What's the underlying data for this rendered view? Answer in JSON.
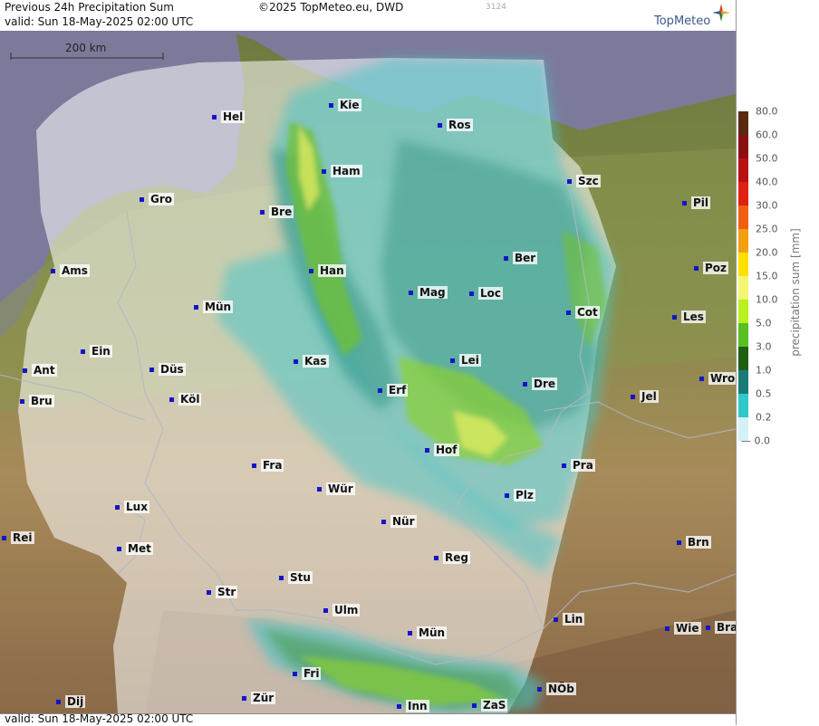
{
  "header": {
    "title": "Previous 24h Precipitation Sum",
    "valid": "valid:  Sun  18-May-2025 02:00 UTC",
    "copyright": "©2025 TopMeteo.eu, DWD",
    "code": "3124",
    "logo": "TopMeteo"
  },
  "scale_bar": {
    "label": "200 km"
  },
  "footer": {
    "valid": "valid:  Sun  18-May-2025 02:00 UTC"
  },
  "legend": {
    "title": "precipitation sum [mm]",
    "items": [
      {
        "label": "80.0",
        "color": "#5a2a10"
      },
      {
        "label": "60.0",
        "color": "#8a1010"
      },
      {
        "label": "50.0",
        "color": "#b81010"
      },
      {
        "label": "40.0",
        "color": "#e02010"
      },
      {
        "label": "30.0",
        "color": "#f06010"
      },
      {
        "label": "25.0",
        "color": "#f2a010"
      },
      {
        "label": "20.0",
        "color": "#ffe000"
      },
      {
        "label": "15.0",
        "color": "#f5f570"
      },
      {
        "label": "10.0",
        "color": "#b8f020"
      },
      {
        "label": "5.0",
        "color": "#58c020"
      },
      {
        "label": "3.0",
        "color": "#1f6010"
      },
      {
        "label": "1.0",
        "color": "#1a7a78"
      },
      {
        "label": "0.5",
        "color": "#30c8c8"
      },
      {
        "label": "0.2",
        "color": "#d4f2f4"
      },
      {
        "label": "0.0",
        "color": "#ffffff"
      }
    ]
  },
  "cities": [
    {
      "name": "Kie"
    },
    {
      "name": "Hel"
    },
    {
      "name": "Ros"
    },
    {
      "name": "Ham"
    },
    {
      "name": "Szc"
    },
    {
      "name": "Gro"
    },
    {
      "name": "Bre"
    },
    {
      "name": "Pil"
    },
    {
      "name": "Ber"
    },
    {
      "name": "Ams"
    },
    {
      "name": "Han"
    },
    {
      "name": "Poz"
    },
    {
      "name": "Mag"
    },
    {
      "name": "Loc"
    },
    {
      "name": "Mün"
    },
    {
      "name": "Cot"
    },
    {
      "name": "Les"
    },
    {
      "name": "Ein"
    },
    {
      "name": "Kas"
    },
    {
      "name": "Lei"
    },
    {
      "name": "Ant"
    },
    {
      "name": "Düs"
    },
    {
      "name": "Wro"
    },
    {
      "name": "Erf"
    },
    {
      "name": "Dre"
    },
    {
      "name": "Bru"
    },
    {
      "name": "Köl"
    },
    {
      "name": "Jel"
    },
    {
      "name": "Hof"
    },
    {
      "name": "Fra"
    },
    {
      "name": "Pra"
    },
    {
      "name": "Wür"
    },
    {
      "name": "Plz"
    },
    {
      "name": "Lux"
    },
    {
      "name": "Nür"
    },
    {
      "name": "Rei"
    },
    {
      "name": "Met"
    },
    {
      "name": "Reg"
    },
    {
      "name": "Brn"
    },
    {
      "name": "Stu"
    },
    {
      "name": "Str"
    },
    {
      "name": "Ulm"
    },
    {
      "name": "Lin"
    },
    {
      "name": "Mün"
    },
    {
      "name": "Wie"
    },
    {
      "name": "Bra"
    },
    {
      "name": "Fri"
    },
    {
      "name": "NÖb"
    },
    {
      "name": "Dij"
    },
    {
      "name": "Zür"
    },
    {
      "name": "Inn"
    },
    {
      "name": "ZaS"
    }
  ]
}
